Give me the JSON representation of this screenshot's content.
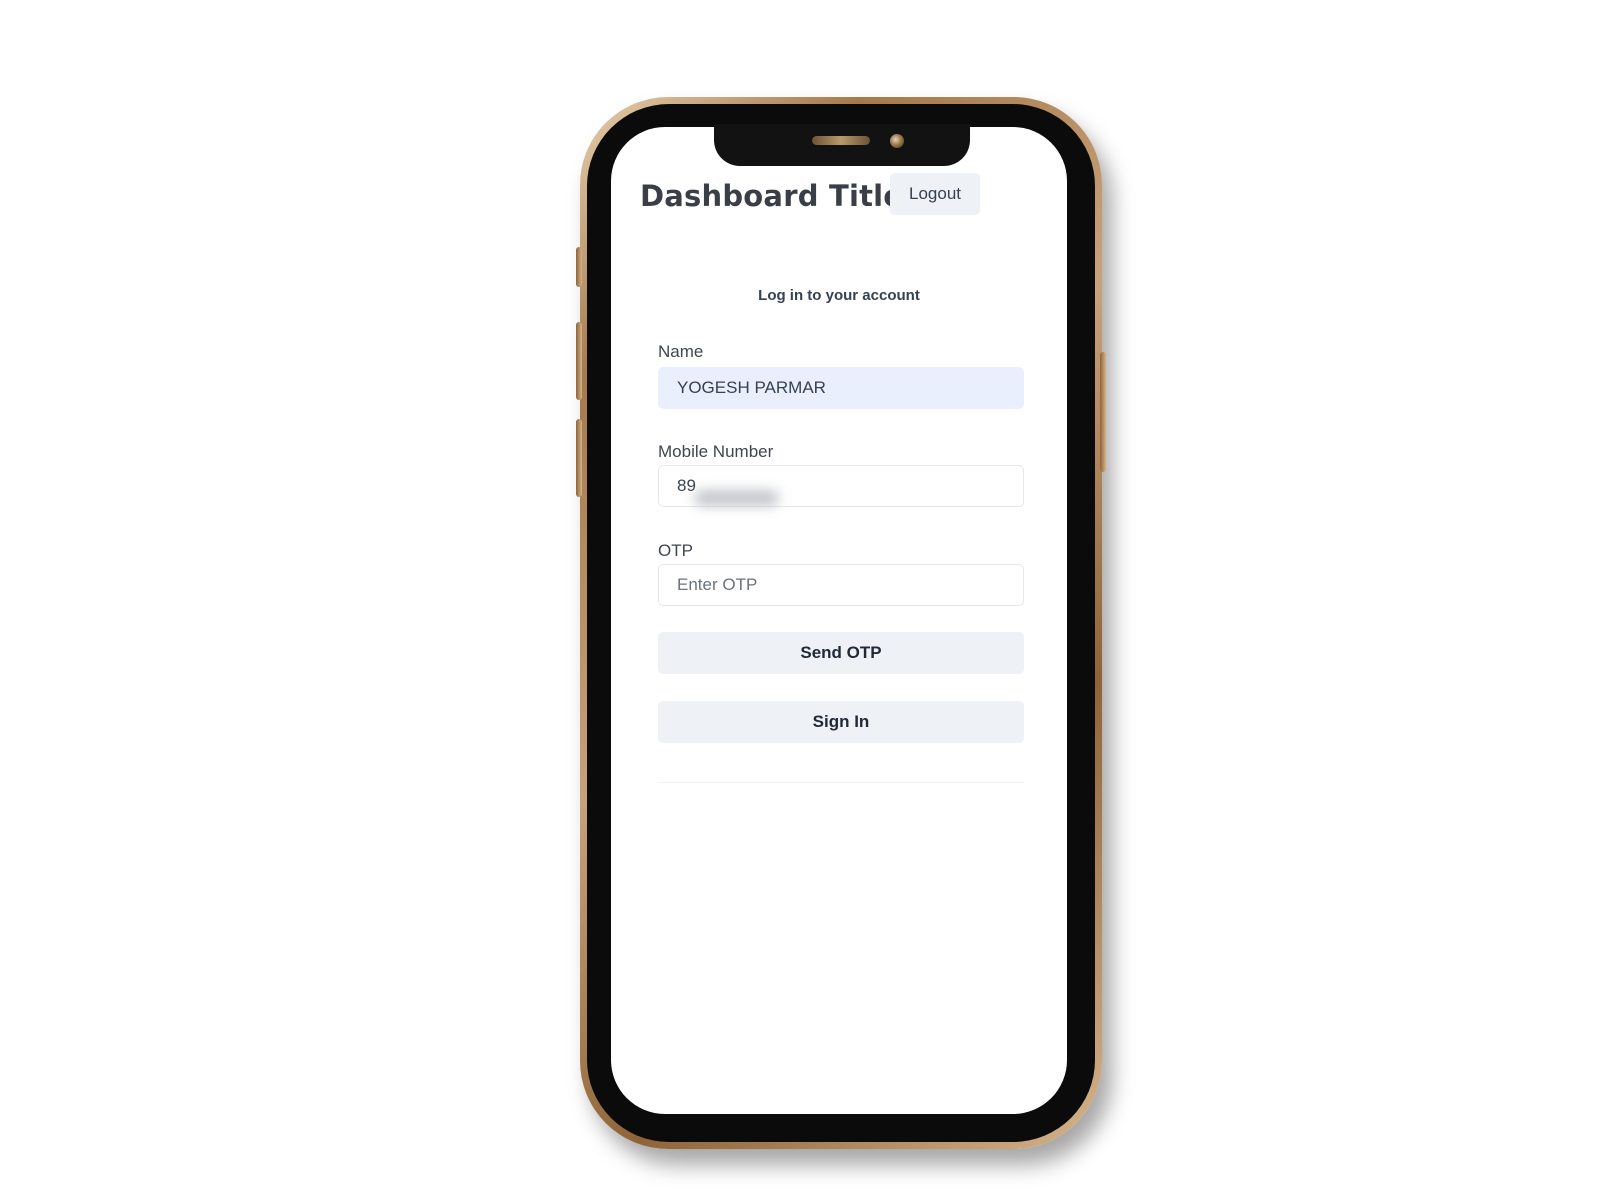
{
  "header": {
    "title": "Dashboard Title",
    "logout_label": "Logout"
  },
  "login_form": {
    "heading": "Log in to your account",
    "name": {
      "label": "Name",
      "value": "YOGESH PARMAR"
    },
    "mobile": {
      "label": "Mobile Number",
      "visible_prefix": "89"
    },
    "otp": {
      "label": "OTP",
      "placeholder": "Enter OTP"
    },
    "send_otp_label": "Send OTP",
    "sign_in_label": "Sign In"
  },
  "colors": {
    "frame_gold": "#c9a27a",
    "bezel": "#0b0b0b",
    "button_bg": "#eef1f5",
    "autofill_bg": "#e9effc",
    "title_text": "#3a3f47"
  }
}
